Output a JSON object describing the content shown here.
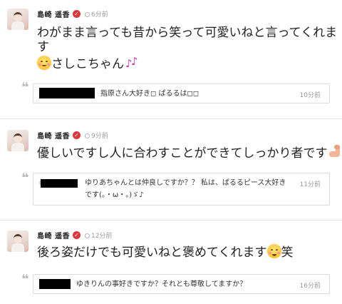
{
  "posts": [
    {
      "author": "島崎 遥香",
      "time": "6分前",
      "text_line1": "わがまま言っても昔から笑って可愛いねと言ってくれま",
      "text_line2": "す",
      "text_line3": "さしこちゃん",
      "emoji_line3_a": "smiling-face-emoji",
      "emoji_line3_b": "musical-notes-emoji",
      "comment": {
        "text": "指原さん大好き◻︎ ぱるるは◻︎◻︎",
        "time": "10分前"
      }
    },
    {
      "author": "島崎 遥香",
      "time": "9分前",
      "text_line1": "優しいですし人に合わすことができてしっかり者です",
      "emoji_line1": "flexed-biceps-emoji",
      "comment": {
        "text_line1": "ゆりあちゃんとは仲良しですか？？ 私は、ぱるるピース大好き",
        "text_line2": "です(。・ω・。)ゞ♪",
        "time": "11分前"
      }
    },
    {
      "author": "島崎 遥香",
      "time": "12分前",
      "text_line1": "後ろ姿だけでも可愛いねと褒めてくれます",
      "text_suffix": "笑",
      "emoji_line1": "grinning-face-emoji",
      "comment": {
        "text": "ゆきりんの事好きですか？それとも尊敬してますか？",
        "time": "16分前"
      }
    }
  ],
  "verified_mark": "✓",
  "quote_mark": "❝",
  "colors": {
    "verified": "#e0343b",
    "note": "#d62fb4",
    "muted": "#9a9a9a",
    "border": "#dcdcdc"
  }
}
